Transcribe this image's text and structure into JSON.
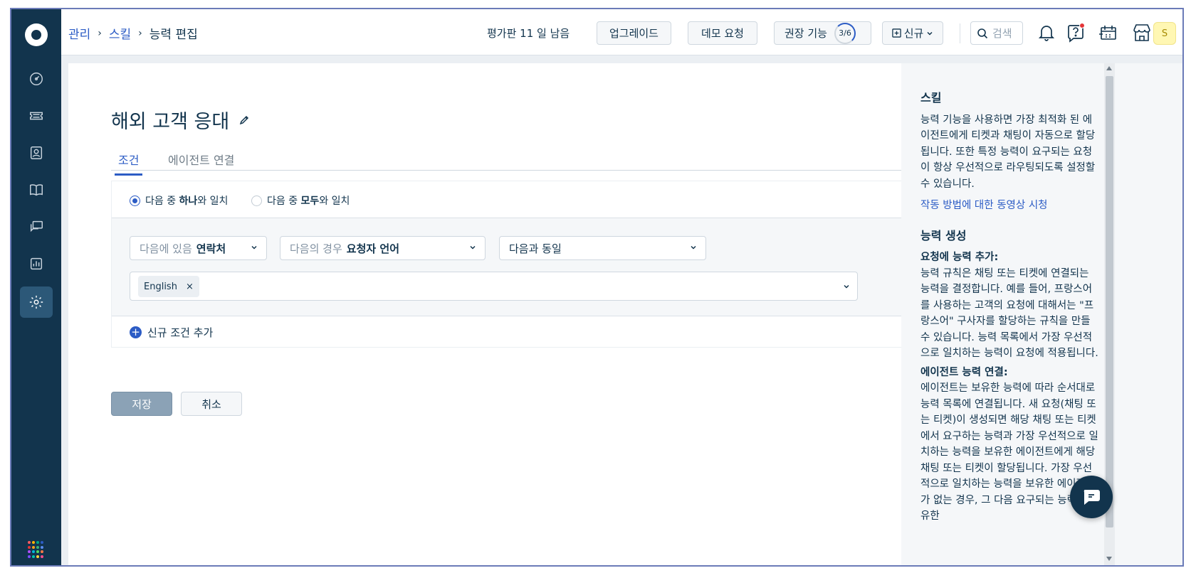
{
  "breadcrumb": {
    "admin": "관리",
    "skills": "스킬",
    "current": "능력 편집",
    "separator": "›"
  },
  "header": {
    "trial_text": "평가판 11 일 남음",
    "upgrade_label": "업그레이드",
    "demo_label": "데모 요청",
    "recommend_label": "권장 기능",
    "recommend_progress": "3/6",
    "new_label": "신규",
    "search_placeholder": "검색",
    "avatar_initial": "S"
  },
  "page": {
    "title": "해외 고객 응대"
  },
  "tabs": [
    {
      "label": "조건",
      "active": true
    },
    {
      "label": "에이전트 연결",
      "active": false
    }
  ],
  "match": {
    "any_prefix": "다음 중 ",
    "any_bold": "하나",
    "any_suffix": "와 일치",
    "any_selected": true,
    "all_prefix": "다음 중 ",
    "all_bold": "모두",
    "all_suffix": "와 일치",
    "all_selected": false
  },
  "rule": {
    "entity_prefix": "다음에 있음",
    "entity_value": "연락처",
    "field_prefix": "다음의 경우",
    "field_value": "요청자 언어",
    "operator_value": "다음과 동일",
    "value_tag": "English",
    "tag_remove": "×"
  },
  "add_condition_label": "신규 조건 추가",
  "actions": {
    "save_label": "저장",
    "cancel_label": "취소"
  },
  "help": {
    "title": "스킬",
    "intro": "능력 기능을 사용하면 가장 최적화 된 에이전트에게 티켓과 채팅이 자동으로 할당됩니다. 또한 특정 능력이 요구되는 요청이 항상 우선적으로 라우팅되도록 설정할 수 있습니다.",
    "video_link": "작동 방법에 대한 동영상 시청",
    "create_title": "능력 생성",
    "add_to_request_title": "요청에 능력 추가:",
    "add_to_request_body": "능력 규칙은 채팅 또는 티켓에 연결되는 능력을 결정합니다. 예를 들어, 프랑스어를 사용하는 고객의 요청에 대해서는 \"프랑스어\" 구사자를 할당하는 규칙을 만들 수 있습니다. 능력 목록에서 가장 우선적으로 일치하는 능력이 요청에 적용됩니다.",
    "agent_link_title": "에이전트 능력 연결:",
    "agent_link_body": "에이전트는 보유한 능력에 따라 순서대로 능력 목록에 연결됩니다. 새 요청(채팅 또는 티켓)이 생성되면 해당 채팅 또는 티켓에서 요구하는 능력과 가장 우선적으로 일치하는 능력을 보유한 에이전트에게 해당 채팅 또는 티켓이 할당됩니다. 가장 우선적으로 일치하는 능력을 보유한 에이전트가 없는 경우, 그 다음 요구되는 능력을 보유한"
  },
  "colors": {
    "sidebar": "#12344d",
    "accent": "#2c5cc5",
    "notification_dot": "#e43538",
    "avatar_bg": "#fff7b3"
  },
  "icons": {
    "sidebar": [
      "dashboard-icon",
      "tickets-icon",
      "contacts-icon",
      "solutions-icon",
      "conversations-icon",
      "reports-icon",
      "admin-settings-icon"
    ],
    "header": [
      "search-icon",
      "bell-icon",
      "help-icon",
      "calendar-icon",
      "marketplace-icon"
    ]
  }
}
